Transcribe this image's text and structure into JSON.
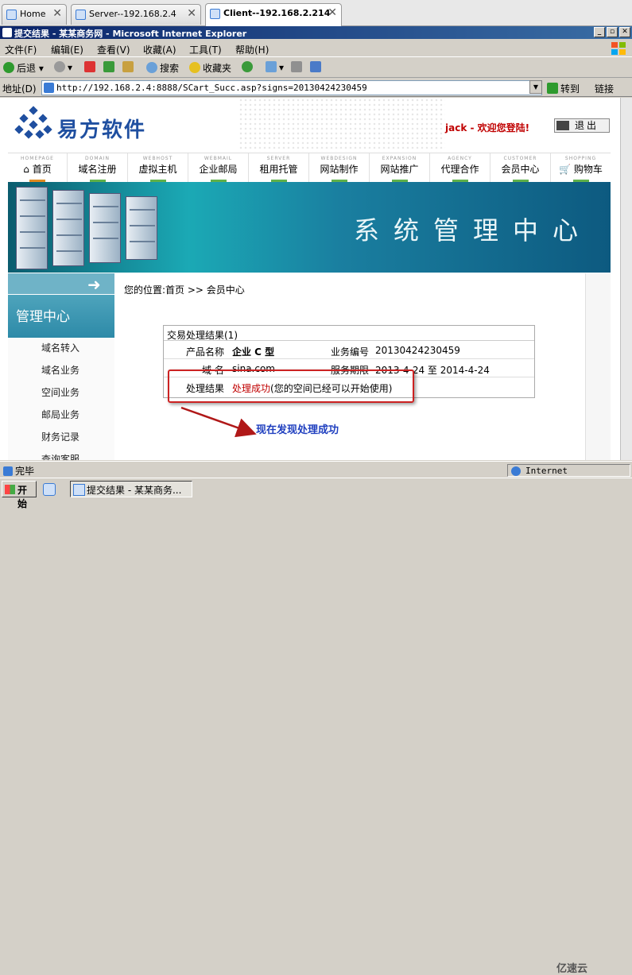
{
  "browser_tabs": [
    {
      "label": "Home",
      "active": false
    },
    {
      "label": "Server--192.168.2.4",
      "active": false
    },
    {
      "label": "Client--192.168.2.214",
      "active": true
    }
  ],
  "window": {
    "title": "提交结果 - 某某商务网 - Microsoft Internet Explorer"
  },
  "menu": [
    "文件(F)",
    "编辑(E)",
    "查看(V)",
    "收藏(A)",
    "工具(T)",
    "帮助(H)"
  ],
  "toolbar": {
    "back": "后退",
    "search": "搜索",
    "favorites": "收藏夹"
  },
  "address": {
    "label": "地址(D)",
    "url": "http://192.168.2.4:8888/SCart_Succ.asp?signs=20130424230459",
    "go": "转到",
    "links": "链接"
  },
  "site": {
    "logo_text": "易方软件",
    "welcome": "jack - 欢迎您登陆!",
    "logout": "退出",
    "nav": [
      {
        "en": "HOMEPAGE",
        "cn": "首页"
      },
      {
        "en": "DOMAIN",
        "cn": "域名注册"
      },
      {
        "en": "WEBHOST",
        "cn": "虚拟主机"
      },
      {
        "en": "WEBMAIL",
        "cn": "企业邮局"
      },
      {
        "en": "SERVER",
        "cn": "租用托管"
      },
      {
        "en": "WEBDESIGN",
        "cn": "网站制作"
      },
      {
        "en": "EXPANSION",
        "cn": "网站推广"
      },
      {
        "en": "AGENCY",
        "cn": "代理合作"
      },
      {
        "en": "CUSTOMER",
        "cn": "会员中心"
      },
      {
        "en": "SHOPPING",
        "cn": "购物车"
      }
    ],
    "banner_text": "系统管理中心",
    "sidebar": {
      "title": "管理中心",
      "items": [
        "域名转入",
        "域名业务",
        "空间业务",
        "邮局业务",
        "财务记录",
        "查询客服"
      ]
    },
    "breadcrumb": "您的位置:首页 >> 会员中心",
    "result_panel": {
      "title": "交易处理结果(1)",
      "product_label": "产品名称",
      "product_value": "企业 C 型",
      "order_label": "业务编号",
      "order_value": "20130424230459",
      "domain_label": "域 名",
      "domain_value": "sina.com",
      "period_label": "服务期限",
      "period_value": "2013-4-24 至 2014-4-24",
      "result_label": "处理结果",
      "result_value": "处理成功",
      "result_note": "(您的空间已经可以开始使用)"
    },
    "annotation": "现在发现处理成功"
  },
  "status": {
    "text": "完毕",
    "zone": "Internet"
  },
  "taskbar": {
    "start": "开始",
    "window": "提交结果 - 某某商务..."
  },
  "watermark": "亿速云",
  "colors": {
    "titlebar": "#0a246a",
    "banner": "#1ba9b5",
    "welcome": "#c00000",
    "annotation": "#1f3fbf",
    "highlight_box": "#cc2222"
  }
}
